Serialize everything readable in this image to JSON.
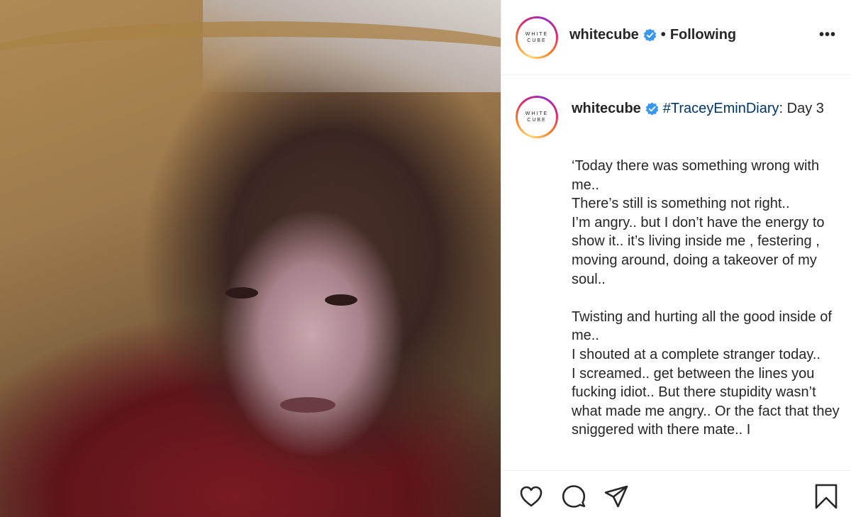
{
  "post": {
    "photo_alt": "selfie photo",
    "account": {
      "username": "whitecube",
      "verified": true,
      "follow_status": "Following",
      "separator": "•",
      "avatar_text_line1": "WHITE",
      "avatar_text_line2": "CUBE"
    },
    "more_label": "•••",
    "caption": {
      "username": "whitecube",
      "hashtag": "#TraceyEminDiary",
      "suffix": ": Day 3",
      "body": "‘Today there was something wrong with me..\nThere’s still is something not right..\n                      I’m angry.. but I don’t have the energy to show it.. it’s living inside me , festering , moving around, doing a takeover of my soul..\n\nTwisting and hurting all the good inside of me..\nI shouted at a complete stranger today..\nI screamed.. get between the lines you fucking idiot.. But there stupidity wasn’t what made me angry.. Or the fact that they sniggered with there mate.. I"
    },
    "actions": {
      "like_icon": "heart-icon",
      "comment_icon": "comment-icon",
      "share_icon": "paper-plane-icon",
      "save_icon": "bookmark-icon"
    },
    "colors": {
      "verified_blue": "#3897f0",
      "hashtag_blue": "#00376b",
      "text": "#262626",
      "divider": "#efefef"
    }
  }
}
